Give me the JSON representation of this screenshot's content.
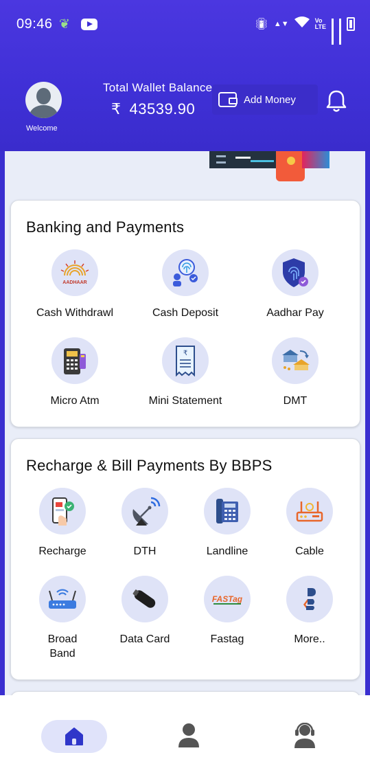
{
  "status_bar": {
    "time": "09:46",
    "icons": [
      "leaf-icon",
      "youtube-icon",
      "vibrate-icon",
      "data-arrows-icon",
      "wifi-icon",
      "volte-icon",
      "signal-icon",
      "signal-icon",
      "battery-icon"
    ]
  },
  "header": {
    "welcome": "Welcome",
    "wallet_label": "Total Wallet Balance",
    "currency_symbol": "₹",
    "wallet_amount": "43539.90",
    "add_money_label": "Add Money",
    "accent": "#3f30d6"
  },
  "banking": {
    "title": "Banking and Payments",
    "items": [
      {
        "label": "Cash Withdrawl",
        "icon": "aadhaar-icon"
      },
      {
        "label": "Cash Deposit",
        "icon": "fingerprint-deposit-icon"
      },
      {
        "label": "Aadhar  Pay",
        "icon": "fingerprint-shield-icon"
      },
      {
        "label": "Micro Atm",
        "icon": "pos-terminal-icon"
      },
      {
        "label": "Mini Statement",
        "icon": "receipt-icon"
      },
      {
        "label": "DMT",
        "icon": "money-transfer-icon"
      }
    ]
  },
  "bbps": {
    "title": "Recharge & Bill Payments By BBPS",
    "items": [
      {
        "label": "Recharge",
        "icon": "mobile-recharge-icon"
      },
      {
        "label": "DTH",
        "icon": "satellite-dish-icon"
      },
      {
        "label": "Landline",
        "icon": "landline-phone-icon"
      },
      {
        "label": "Cable",
        "icon": "cable-box-icon"
      },
      {
        "label": "Broad\nBand",
        "label_line1": "Broad",
        "label_line2": "Band",
        "icon": "router-icon"
      },
      {
        "label": "Data Card",
        "icon": "usb-datacard-icon"
      },
      {
        "label": "Fastag",
        "icon": "fastag-icon",
        "icon_text": "FASTag"
      },
      {
        "label": "More..",
        "icon": "bbps-logo-icon"
      }
    ]
  },
  "nav": {
    "items": [
      "home-icon",
      "profile-icon",
      "support-icon"
    ],
    "active": "home"
  }
}
